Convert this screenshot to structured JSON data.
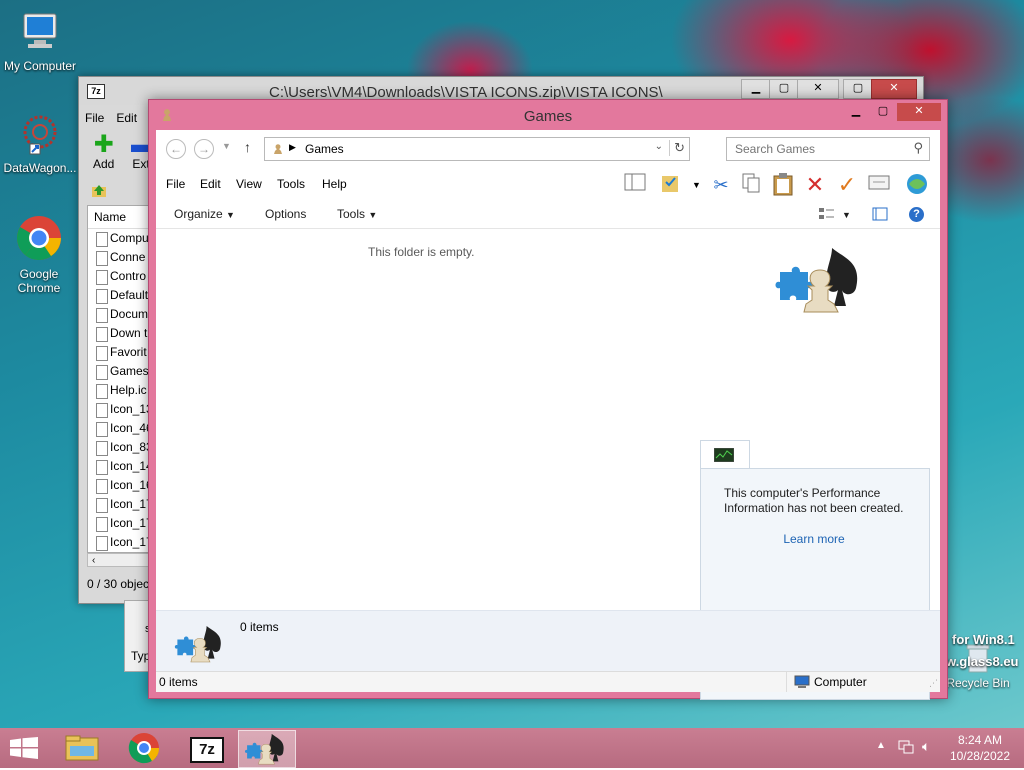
{
  "desktop": {
    "icons": [
      {
        "label": "My Computer"
      },
      {
        "label": "DataWagon..."
      },
      {
        "label": "Google Chrome"
      },
      {
        "label": "Recycle Bin"
      }
    ],
    "watermark_line1": "for Win8.1",
    "watermark_line2": "w.glass8.eu"
  },
  "sevenzip": {
    "title": "C:\\Users\\VM4\\Downloads\\VISTA ICONS.zip\\VISTA ICONS\\",
    "menu": [
      "File",
      "Edit"
    ],
    "toolbar": {
      "add": "Add",
      "extract": "Extr"
    },
    "column_name": "Name",
    "files": [
      "Compu",
      "Conne",
      "Contro",
      "Default",
      "Docum",
      "Down t",
      "Favorit",
      "Games.",
      "Help.ic",
      "Icon_13",
      "Icon_46",
      "Icon_83",
      "Icon_14",
      "Icon_16",
      "Icon_17",
      "Icon_17",
      "Icon_17"
    ],
    "status": "0 / 30 objec",
    "under_s": "s",
    "under_typ": "Typ"
  },
  "games": {
    "title": "Games",
    "breadcrumb": "Games",
    "search_placeholder": "Search Games",
    "menu": [
      "File",
      "Edit",
      "View",
      "Tools",
      "Help"
    ],
    "commands": {
      "organize": "Organize",
      "options": "Options",
      "tools": "Tools"
    },
    "empty_message": "This folder is empty.",
    "task_text": "This computer's Performance Information has not been created.",
    "learn_more": "Learn more",
    "details_count": "0 items",
    "status_items": "0 items",
    "status_location": "Computer",
    "colors": {
      "frame": "#e3789d",
      "link": "#1e64b4"
    }
  },
  "taskbar": {
    "time": "8:24 AM",
    "date": "10/28/2022",
    "sevenzip_label": "7z"
  }
}
